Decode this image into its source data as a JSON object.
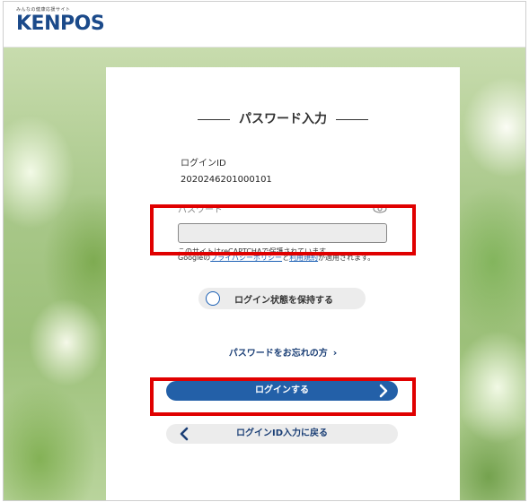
{
  "header": {
    "tagline": "みんなの健康応援サイト",
    "logo": "KENPOS"
  },
  "form": {
    "title": "パスワード入力",
    "login_id_label": "ログインID",
    "login_id_value": "2020246201000101",
    "password_label": "パスワード",
    "password_value": "",
    "recaptcha_line1": "このサイトはreCAPTCHAで保護されています。",
    "recaptcha_google": "Googleの",
    "recaptcha_privacy": "プライバシーポリシー",
    "recaptcha_and": "と",
    "recaptcha_terms": "利用規約",
    "recaptcha_tail": "が適用されます。",
    "remember_label": "ログイン状態を保持する",
    "forgot_label": "パスワードをお忘れの方",
    "forgot_chevron": "›",
    "login_button_label": "ログインする",
    "back_button_label": "ログインID入力に戻る"
  },
  "colors": {
    "brand": "#1b4a8a",
    "primary_button": "#2360a8",
    "highlight": "#e00000"
  }
}
